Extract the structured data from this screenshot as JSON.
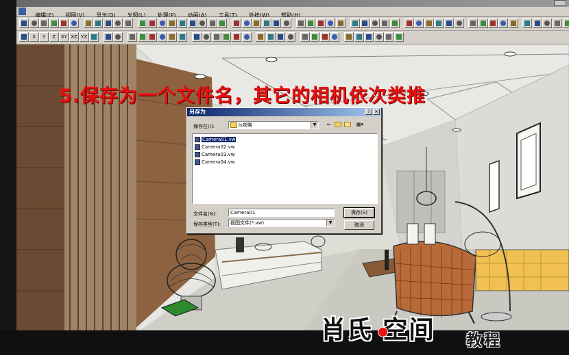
{
  "window": {
    "title": "",
    "menu": [
      "编辑(E)",
      "视图(V)",
      "显示(D)",
      "光照(L)",
      "处理(P)",
      "动画(A)",
      "工具(T)",
      "外挂(W)",
      "帮助(H)"
    ]
  },
  "toolbar": {
    "axis_buttons": [
      "X",
      "Y",
      "Z",
      "XY",
      "XZ",
      "YZ"
    ]
  },
  "caption": "5.保存为一个文件名，其它的相机依次类推",
  "save_dialog": {
    "title": "另存为",
    "help_button": "?",
    "close_button": "×",
    "save_in_label": "保存在(I):",
    "save_in_value": "ls攻略",
    "files": [
      "Camera01.vw",
      "Camera02.vw",
      "Camera03.vw",
      "Camera04.vw"
    ],
    "filename_label": "文件名(N):",
    "filename_value": "Camera01",
    "filetype_label": "保存类型(T):",
    "filetype_value": "视图文件(*.vw)",
    "save_button": "保存(S)",
    "cancel_button": "取消"
  },
  "watermark": {
    "brand": "肖氏 空间",
    "subtitle": "教程"
  },
  "colors": {
    "caption_red": "#e81010",
    "dialog_title_blue": "#0a246a",
    "wood_brown": "#8c6240"
  }
}
